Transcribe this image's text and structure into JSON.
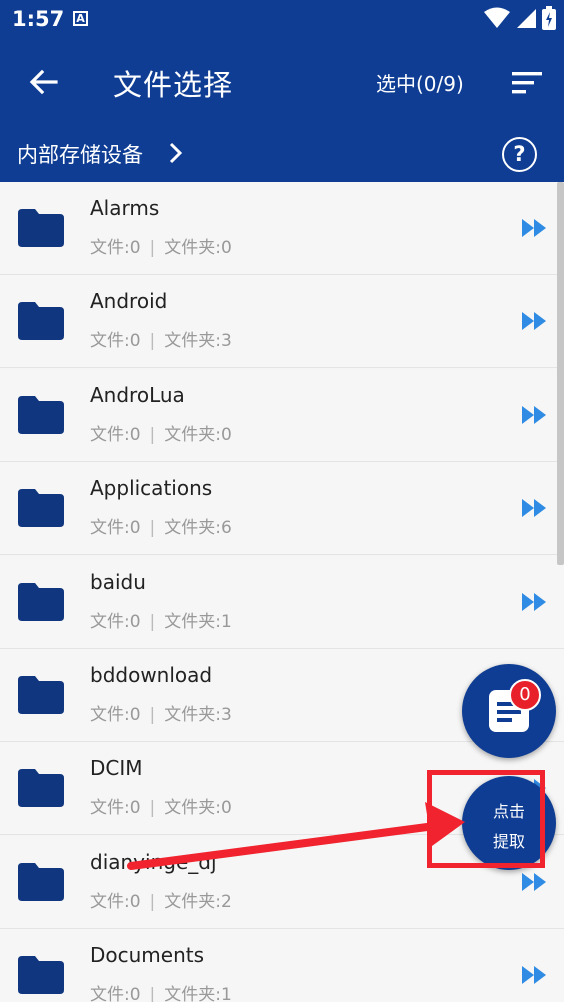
{
  "status_bar": {
    "time": "1:57",
    "indicator": "A"
  },
  "toolbar": {
    "title": "文件选择",
    "selected_count": "选中(0/9)"
  },
  "path_bar": {
    "current_path": "内部存储设备",
    "help_symbol": "?"
  },
  "files": [
    {
      "name": "Alarms",
      "files_label": "文件:0",
      "sep": "|",
      "folders_label": "文件夹:0"
    },
    {
      "name": "Android",
      "files_label": "文件:0",
      "sep": "|",
      "folders_label": "文件夹:3"
    },
    {
      "name": "AndroLua",
      "files_label": "文件:0",
      "sep": "|",
      "folders_label": "文件夹:0"
    },
    {
      "name": "Applications",
      "files_label": "文件:0",
      "sep": "|",
      "folders_label": "文件夹:6"
    },
    {
      "name": "baidu",
      "files_label": "文件:0",
      "sep": "|",
      "folders_label": "文件夹:1"
    },
    {
      "name": "bddownload",
      "files_label": "文件:0",
      "sep": "|",
      "folders_label": "文件夹:3"
    },
    {
      "name": "DCIM",
      "files_label": "文件:0",
      "sep": "|",
      "folders_label": "文件夹:0"
    },
    {
      "name": "dianyinge_dj",
      "files_label": "文件:0",
      "sep": "|",
      "folders_label": "文件夹:2"
    },
    {
      "name": "Documents",
      "files_label": "文件:0",
      "sep": "|",
      "folders_label": "文件夹:1"
    }
  ],
  "fab": {
    "badge_count": "0",
    "extract_line1": "点击",
    "extract_line2": "提取"
  },
  "colors": {
    "primary": "#0e3d93",
    "folder": "#10367f",
    "enter_arrow": "#2f8be3",
    "annotation": "#f0232e",
    "badge": "#e8202a"
  }
}
